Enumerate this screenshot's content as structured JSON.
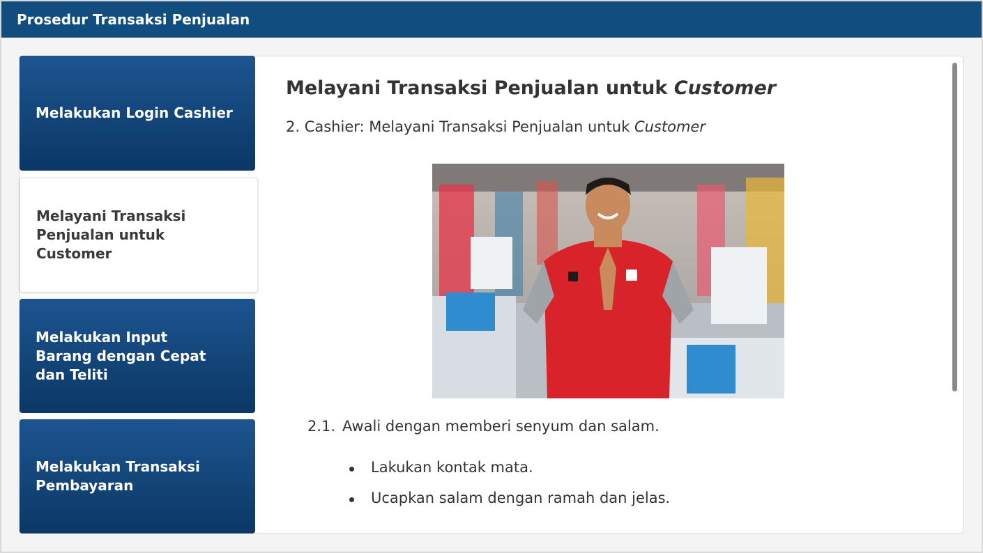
{
  "header": {
    "title": "Prosedur Transaksi Penjualan"
  },
  "sidebar": {
    "items": [
      {
        "label": "Melakukan Login Cashier",
        "active": false
      },
      {
        "label": "Melayani Transaksi Penjualan untuk Customer",
        "active": true
      },
      {
        "label": "Melakukan Input Barang dengan Cepat dan Teliti",
        "active": false
      },
      {
        "label": "Melakukan Transaksi Pembayaran",
        "active": false
      }
    ]
  },
  "main": {
    "heading_prefix": "Melayani Transaksi Penjualan untuk ",
    "heading_italic": "Customer",
    "step_prefix": "2.  Cashier: Melayani Transaksi Penjualan untuk ",
    "step_italic": "Customer",
    "photo_icon": "cashier-photo",
    "substep_number": "2.1.",
    "substep_text": "Awali dengan memberi senyum dan salam.",
    "bullets": [
      "Lakukan kontak mata.",
      "Ucapkan salam dengan ramah dan jelas."
    ]
  },
  "colors": {
    "header": "#124d80",
    "menu_dark_top": "#1d5490",
    "menu_dark_bottom": "#0b3865"
  }
}
